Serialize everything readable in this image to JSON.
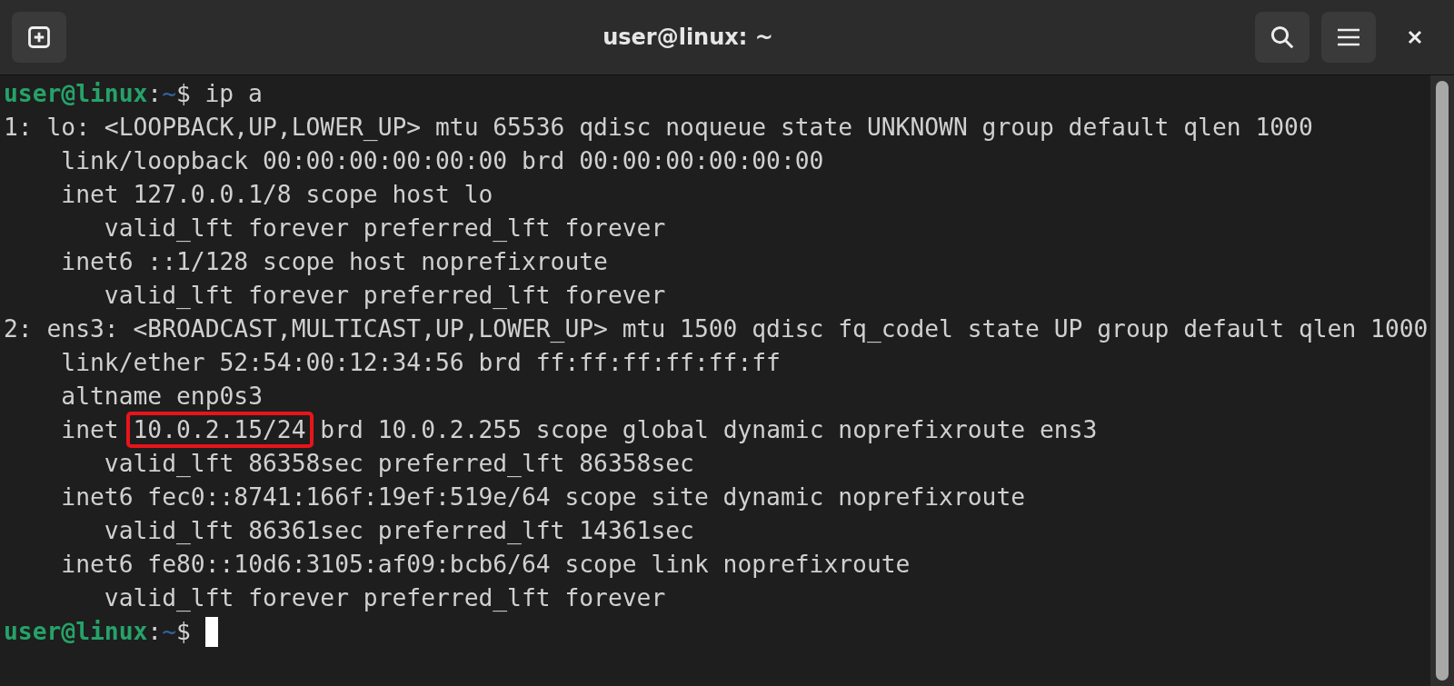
{
  "window": {
    "title": "user@linux: ~"
  },
  "terminal": {
    "lines": [
      {
        "kind": "prompt",
        "user_host": "user@linux",
        "separator": ":",
        "path": "~",
        "symbol": "$",
        "command": "ip a",
        "cursor": false
      },
      {
        "kind": "output",
        "parts": [
          {
            "text": "1: lo: <LOOPBACK,UP,LOWER_UP> mtu 65536 qdisc noqueue state UNKNOWN group default qlen 1000",
            "highlighted": false
          }
        ]
      },
      {
        "kind": "output",
        "parts": [
          {
            "text": "    link/loopback 00:00:00:00:00:00 brd 00:00:00:00:00:00",
            "highlighted": false
          }
        ]
      },
      {
        "kind": "output",
        "parts": [
          {
            "text": "    inet 127.0.0.1/8 scope host lo",
            "highlighted": false
          }
        ]
      },
      {
        "kind": "output",
        "parts": [
          {
            "text": "       valid_lft forever preferred_lft forever",
            "highlighted": false
          }
        ]
      },
      {
        "kind": "output",
        "parts": [
          {
            "text": "    inet6 ::1/128 scope host noprefixroute",
            "highlighted": false
          }
        ]
      },
      {
        "kind": "output",
        "parts": [
          {
            "text": "       valid_lft forever preferred_lft forever",
            "highlighted": false
          }
        ]
      },
      {
        "kind": "output",
        "parts": [
          {
            "text": "2: ens3: <BROADCAST,MULTICAST,UP,LOWER_UP> mtu 1500 qdisc fq_codel state UP group default qlen 1000",
            "highlighted": false
          }
        ]
      },
      {
        "kind": "output",
        "parts": [
          {
            "text": "    link/ether 52:54:00:12:34:56 brd ff:ff:ff:ff:ff:ff",
            "highlighted": false
          }
        ]
      },
      {
        "kind": "output",
        "parts": [
          {
            "text": "    altname enp0s3",
            "highlighted": false
          }
        ]
      },
      {
        "kind": "output",
        "parts": [
          {
            "text": "    inet",
            "highlighted": false
          },
          {
            "text": "10.0.2.15/24",
            "highlighted": true
          },
          {
            "text": "brd 10.0.2.255 scope global dynamic noprefixroute ens3",
            "highlighted": false
          }
        ]
      },
      {
        "kind": "output",
        "parts": [
          {
            "text": "       valid_lft 86358sec preferred_lft 86358sec",
            "highlighted": false
          }
        ]
      },
      {
        "kind": "output",
        "parts": [
          {
            "text": "    inet6 fec0::8741:166f:19ef:519e/64 scope site dynamic noprefixroute",
            "highlighted": false
          }
        ]
      },
      {
        "kind": "output",
        "parts": [
          {
            "text": "       valid_lft 86361sec preferred_lft 14361sec",
            "highlighted": false
          }
        ]
      },
      {
        "kind": "output",
        "parts": [
          {
            "text": "    inet6 fe80::10d6:3105:af09:bcb6/64 scope link noprefixroute",
            "highlighted": false
          }
        ]
      },
      {
        "kind": "output",
        "parts": [
          {
            "text": "       valid_lft forever preferred_lft forever",
            "highlighted": false
          }
        ]
      },
      {
        "kind": "prompt",
        "user_host": "user@linux",
        "separator": ":",
        "path": "~",
        "symbol": "$",
        "cursor": true
      }
    ]
  }
}
